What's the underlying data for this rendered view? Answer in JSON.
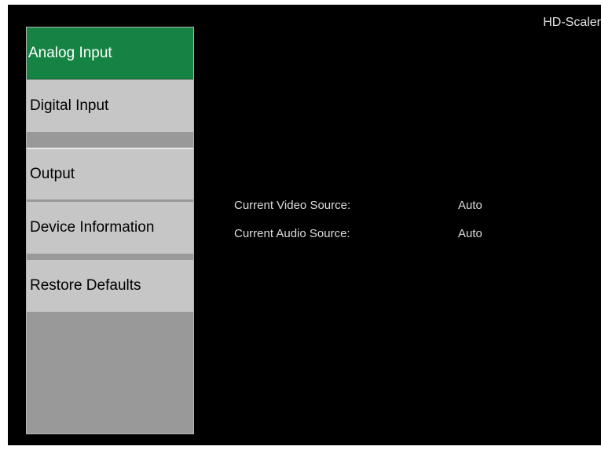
{
  "header": {
    "device_name": "HD-Scaler"
  },
  "menu": {
    "items": [
      {
        "label": "Analog Input",
        "active": true
      },
      {
        "label": "Digital Input",
        "active": false
      },
      {
        "label": "Output",
        "active": false
      },
      {
        "label": "Device Information",
        "active": false
      },
      {
        "label": "Restore Defaults",
        "active": false
      }
    ]
  },
  "status": {
    "video_label": "Current Video Source:",
    "video_value": "Auto",
    "audio_label": "Current Audio Source:",
    "audio_value": "Auto"
  },
  "colors": {
    "background": "#000000",
    "active_menu": "#158442",
    "menu_item": "#c6c6c6",
    "menu_panel": "#999999"
  }
}
